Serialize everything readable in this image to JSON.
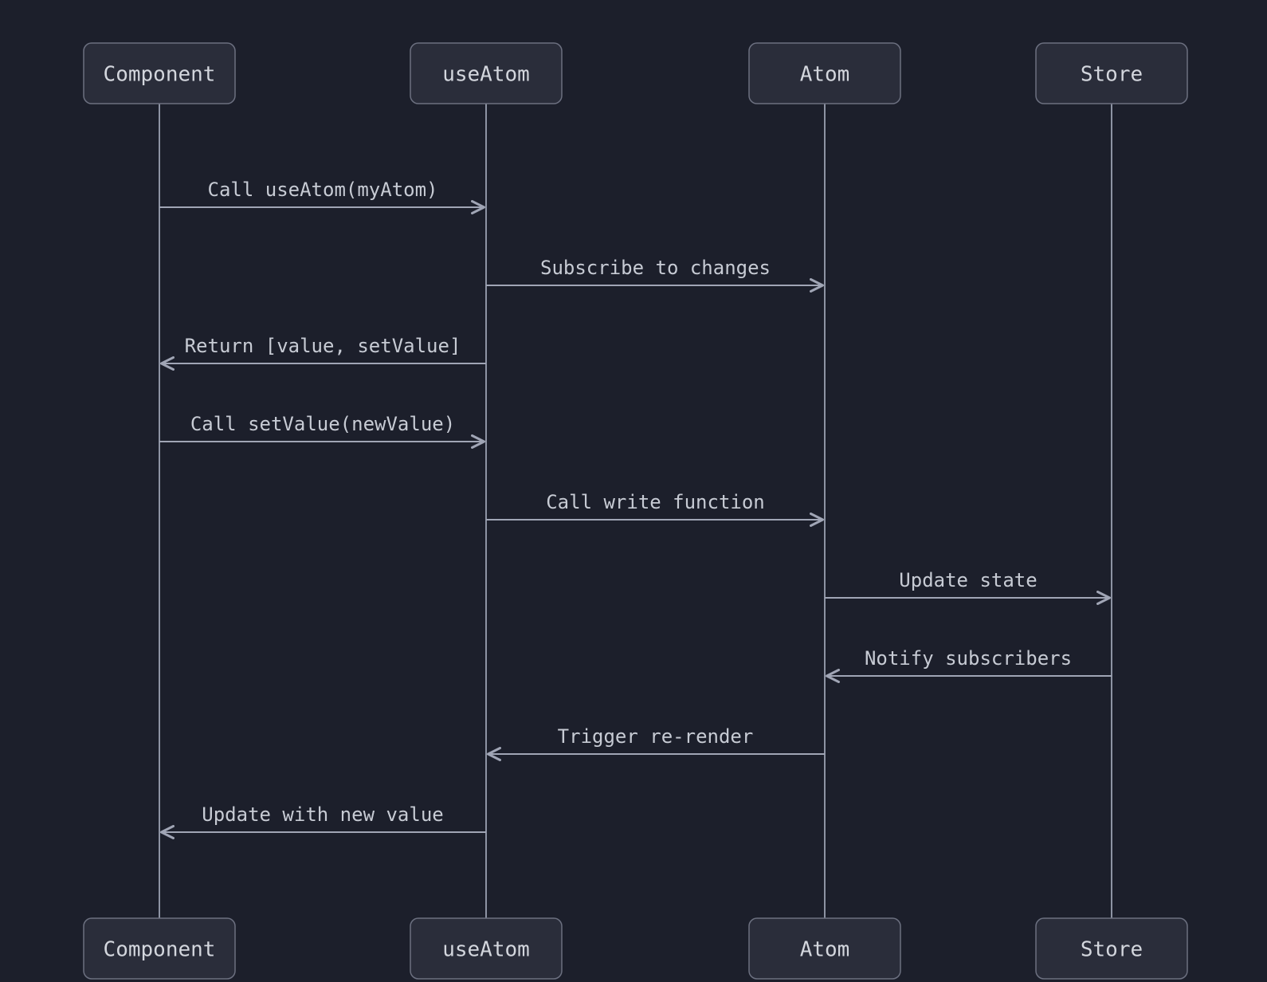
{
  "chart_data": {
    "type": "sequence-diagram",
    "actors": [
      {
        "id": "component",
        "label": "Component"
      },
      {
        "id": "useAtom",
        "label": "useAtom"
      },
      {
        "id": "atom",
        "label": "Atom"
      },
      {
        "id": "store",
        "label": "Store"
      }
    ],
    "messages": [
      {
        "from": "component",
        "to": "useAtom",
        "label": "Call useAtom(myAtom)"
      },
      {
        "from": "useAtom",
        "to": "atom",
        "label": "Subscribe to changes"
      },
      {
        "from": "useAtom",
        "to": "component",
        "label": "Return [value, setValue]"
      },
      {
        "from": "component",
        "to": "useAtom",
        "label": "Call setValue(newValue)"
      },
      {
        "from": "useAtom",
        "to": "atom",
        "label": "Call write function"
      },
      {
        "from": "atom",
        "to": "store",
        "label": "Update state"
      },
      {
        "from": "store",
        "to": "atom",
        "label": "Notify subscribers"
      },
      {
        "from": "atom",
        "to": "useAtom",
        "label": "Trigger re-render"
      },
      {
        "from": "useAtom",
        "to": "component",
        "label": "Update with new value"
      }
    ]
  }
}
